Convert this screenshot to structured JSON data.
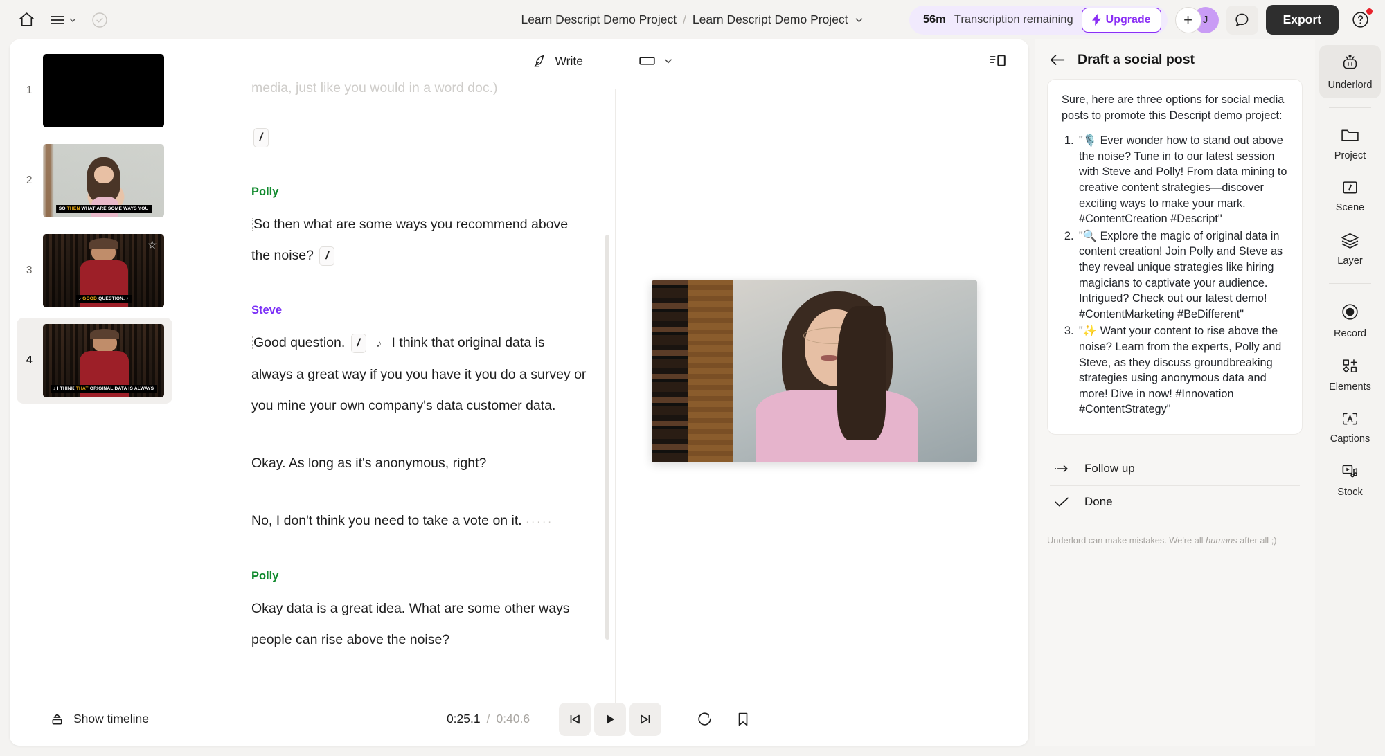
{
  "topbar": {
    "home_icon": "home-icon",
    "menu_icon": "hamburger-menu-icon",
    "menu_caret_icon": "chevron-down-icon",
    "check_icon": "check-circle-icon",
    "breadcrumb": [
      "Learn Descript Demo Project",
      "Learn Descript Demo Project"
    ],
    "breadcrumb_separator": "/",
    "breadcrumb_caret_icon": "chevron-down-icon",
    "transcription_minutes": "56m",
    "transcription_label": "Transcription remaining",
    "upgrade_label": "Upgrade",
    "upgrade_icon": "lightning-bolt-icon",
    "add_collaborator": "+",
    "avatar_initial": "J",
    "comment_icon": "comment-bubble-icon",
    "export_label": "Export",
    "help_icon": "question-circle-icon",
    "accent_purple": "#8b2ff5",
    "notification_dot": "#e8222b"
  },
  "thumbnails": [
    {
      "number": "1",
      "kind": "black-slide",
      "caption": "",
      "starred": false,
      "selected": false
    },
    {
      "number": "2",
      "kind": "polly-webcam",
      "caption_pre": "SO ",
      "caption_hl": "THEN",
      "caption_post": " WHAT ARE SOME WAYS YOU",
      "starred": false,
      "selected": false
    },
    {
      "number": "3",
      "kind": "steve-webcam",
      "caption_pre": "♪ ",
      "caption_hl": "GOOD",
      "caption_post": " QUESTION. ♪",
      "starred": true,
      "selected": false
    },
    {
      "number": "4",
      "kind": "steve-webcam",
      "caption_pre": "♪ I THINK ",
      "caption_hl": "THAT",
      "caption_post": " ORIGINAL DATA IS ALWAYS",
      "starred": false,
      "selected": true
    }
  ],
  "transcript": {
    "write_label": "Write",
    "write_icon": "quill-pen-icon",
    "faded_line": "media, just like you would in a word doc.)",
    "scene_chip": "/",
    "blocks": [
      {
        "speaker": "Polly",
        "speaker_color": "#118a2e",
        "lines": [
          "So then what are some ways you recommend above the noise?"
        ],
        "trailing_scene": "/"
      },
      {
        "speaker": "Steve",
        "speaker_color": "#7b2ff7",
        "first_segment": "Good question.",
        "inline_scene": "/",
        "music_icon": "music-note-icon",
        "lines": [
          "I think that original data is always a great way if you you have it you do a survey or you mine your own company's data customer data.",
          "Okay. As long as it's anonymous, right?",
          "No, I don't think you need to take a vote on it."
        ],
        "trailing_dots": "·····"
      },
      {
        "speaker": "Polly",
        "speaker_color": "#118a2e",
        "lines": [
          "Okay data is a great idea. What are some other ways people can rise above the noise?"
        ]
      }
    ]
  },
  "canvas": {
    "aspect_icon": "rectangle-16-9-icon",
    "aspect_caret_icon": "chevron-down-icon",
    "panel_toggle_icon": "toggle-side-panel-icon"
  },
  "bottombar": {
    "show_timeline_label": "Show timeline",
    "show_timeline_icon": "timeline-expand-icon",
    "current_time": "0:25.1",
    "time_separator": "/",
    "total_time": "0:40.6",
    "prev_icon": "skip-to-start-icon",
    "play_icon": "play-icon",
    "next_icon": "skip-to-end-icon",
    "loop_icon": "loop-playback-icon",
    "bookmark_icon": "bookmark-icon"
  },
  "ai_panel": {
    "back_icon": "arrow-left-icon",
    "title": "Draft a social post",
    "intro": "Sure, here are three options for social media posts to promote this Descript demo project:",
    "options": [
      "\"🎙️ Ever wonder how to stand out above the noise? Tune in to our latest session with Steve and Polly! From data mining to creative content strategies—discover exciting ways to make your mark. #ContentCreation #Descript\"",
      "\"🔍 Explore the magic of original data in content creation! Join Polly and Steve as they reveal unique strategies like hiring magicians to captivate your audience. Intrigued? Check out our latest demo! #ContentMarketing #BeDifferent\"",
      "\"✨ Want your content to rise above the noise? Learn from the experts, Polly and Steve, as they discuss groundbreaking strategies using anonymous data and more! Dive in now! #Innovation #ContentStrategy\""
    ],
    "follow_up_label": "Follow up",
    "follow_up_icon": "arrow-follow-up-icon",
    "done_label": "Done",
    "done_icon": "checkmark-icon",
    "disclaimer_pre": "Underlord can make mistakes. We're all ",
    "disclaimer_em": "humans",
    "disclaimer_post": " after all ;)"
  },
  "rail": [
    {
      "label": "Underlord",
      "icon": "robot-icon",
      "active": true
    },
    {
      "label": "Project",
      "icon": "folder-icon",
      "active": false
    },
    {
      "label": "Scene",
      "icon": "scene-slash-icon",
      "active": false
    },
    {
      "label": "Layer",
      "icon": "layers-icon",
      "active": false
    },
    {
      "label": "Record",
      "icon": "record-circle-icon",
      "active": false
    },
    {
      "label": "Elements",
      "icon": "elements-shapes-icon",
      "active": false
    },
    {
      "label": "Captions",
      "icon": "captions-a-icon",
      "active": false
    },
    {
      "label": "Stock",
      "icon": "stock-media-icon",
      "active": false
    }
  ]
}
